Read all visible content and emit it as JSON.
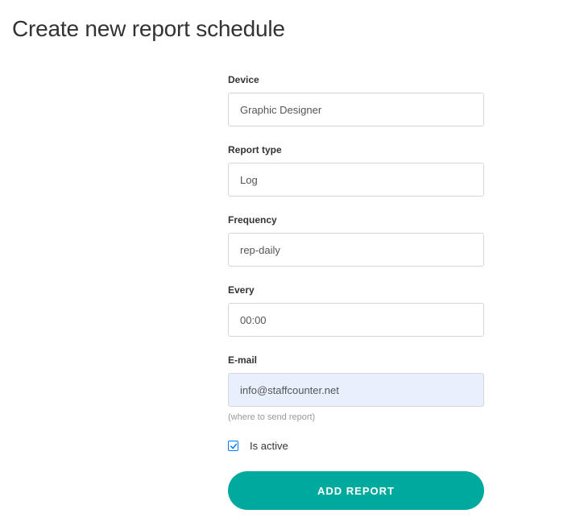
{
  "page": {
    "title": "Create new report schedule"
  },
  "form": {
    "device": {
      "label": "Device",
      "value": "Graphic Designer"
    },
    "report_type": {
      "label": "Report type",
      "value": "Log"
    },
    "frequency": {
      "label": "Frequency",
      "value": "rep-daily"
    },
    "every": {
      "label": "Every",
      "value": "00:00"
    },
    "email": {
      "label": "E-mail",
      "value": "info@staffcounter.net",
      "helper": "(where to send report)"
    },
    "is_active": {
      "label": "Is active",
      "checked": true
    },
    "submit": {
      "label": "ADD REPORT"
    }
  },
  "colors": {
    "accent": "#00a99d",
    "checkbox": "#007bff"
  }
}
